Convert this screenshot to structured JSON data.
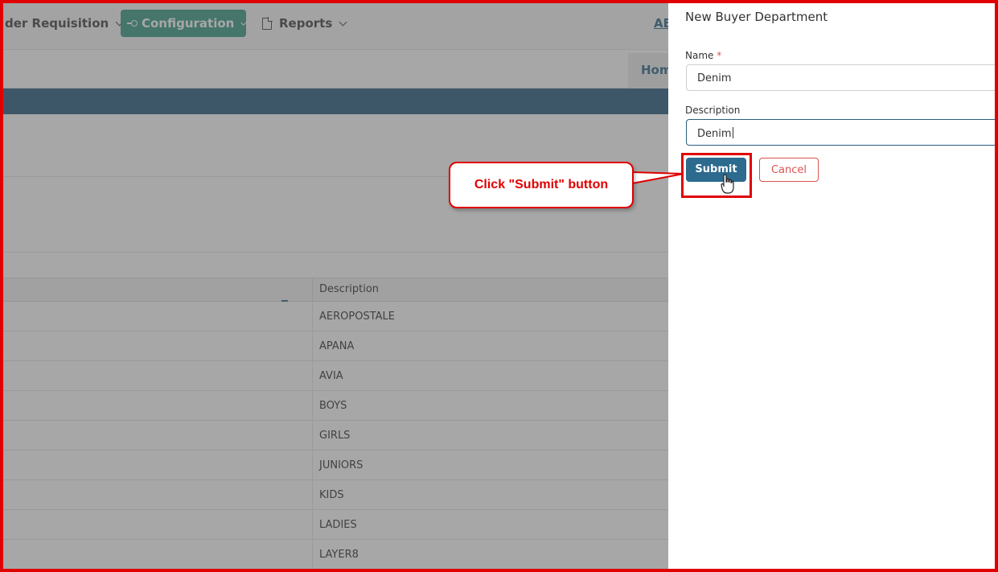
{
  "nav": {
    "order_req_label": "der Requisition",
    "config_label": "Configuration",
    "reports_label": "Reports",
    "user_label": "AB"
  },
  "subnav": {
    "home_label": "Hom"
  },
  "table": {
    "header_description": "Description",
    "rows": [
      "AEROPOSTALE",
      "APANA",
      "AVIA",
      "BOYS",
      "GIRLS",
      "JUNIORS",
      "KIDS",
      "LADIES",
      "LAYER8"
    ]
  },
  "panel": {
    "title": "New Buyer Department",
    "name_label": "Name",
    "required_mark": "*",
    "name_value": "Denim",
    "description_label": "Description",
    "description_value": "Denim",
    "submit_label": "Submit",
    "cancel_label": "Cancel"
  },
  "annotation": {
    "callout_text": "Click \"Submit\" button"
  },
  "colors": {
    "accent": "#3a9a86",
    "primary": "#2c6a8e",
    "danger": "#d9534f",
    "annotation_red": "#e00000"
  }
}
